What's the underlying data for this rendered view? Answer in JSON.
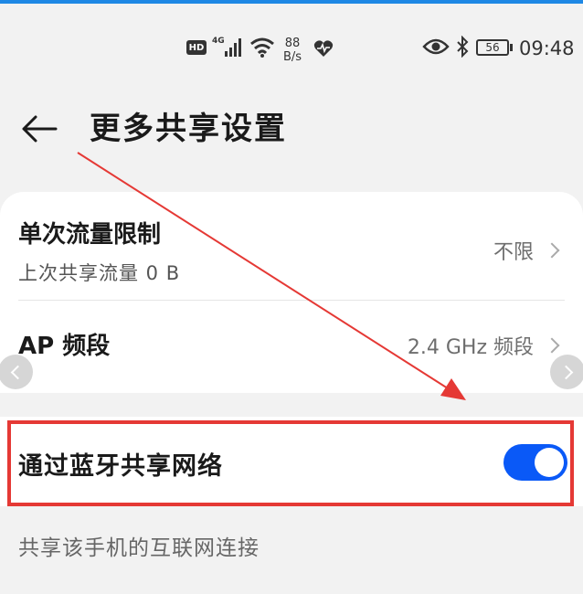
{
  "status_bar": {
    "hd": "HD",
    "network": "4G",
    "speed_value": "88",
    "speed_unit": "B/s",
    "battery": "56",
    "time": "09:48",
    "icons": [
      "signal-icon",
      "wifi-icon",
      "heart-rate-icon",
      "eye-icon",
      "bluetooth-icon",
      "battery-icon"
    ]
  },
  "header": {
    "back_icon": "arrow-left-icon",
    "title": "更多共享设置"
  },
  "settings": [
    {
      "title": "单次流量限制",
      "subtitle": "上次共享流量 0 B",
      "value": "不限"
    },
    {
      "title": "AP 频段",
      "value": "2.4 GHz 频段"
    }
  ],
  "bluetooth_share": {
    "label": "通过蓝牙共享网络",
    "enabled": true,
    "description": "共享该手机的互联网连接"
  },
  "colors": {
    "accent": "#0a59f7",
    "highlight": "#e53935",
    "background": "#f2f2f2"
  }
}
